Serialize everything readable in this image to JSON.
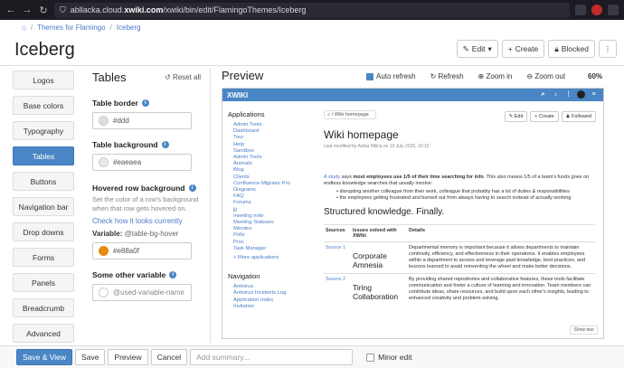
{
  "browser": {
    "url_prefix": "abllacka.cloud.",
    "url_domain": "xwiki.com",
    "url_path": "/xwiki/bin/edit/FlamingoThemes/Iceberg"
  },
  "breadcrumb": {
    "home": "⌂",
    "section": "Themes for Flamingo",
    "page": "Iceberg"
  },
  "page": {
    "title": "Iceberg"
  },
  "toolbar": {
    "edit": "Edit",
    "create": "Create",
    "blocked": "Blocked"
  },
  "sidebar": {
    "items": [
      {
        "label": "Logos"
      },
      {
        "label": "Base colors"
      },
      {
        "label": "Typography"
      },
      {
        "label": "Tables",
        "active": true
      },
      {
        "label": "Buttons"
      },
      {
        "label": "Navigation bar"
      },
      {
        "label": "Drop downs"
      },
      {
        "label": "Forms"
      },
      {
        "label": "Panels"
      },
      {
        "label": "Breadcrumb"
      },
      {
        "label": "Advanced"
      }
    ]
  },
  "tables": {
    "title": "Tables",
    "reset": "Reset all",
    "border_label": "Table border",
    "border_value": "#ddd",
    "border_color": "#dddddd",
    "bg_label": "Table background",
    "bg_value": "#eaeaea",
    "bg_color": "#eaeaea",
    "hover_label": "Hovered row background",
    "hover_hint": "Set the color of a row's background when that row gets hovered on.",
    "hover_link": "Check how it looks currently",
    "var_prefix": "Variable:",
    "var_name": "@table-bg-hover",
    "hover_value": "#e88a0f",
    "hover_color": "#e88a0f",
    "other_label": "Some other variable",
    "other_placeholder": "@used-variable-name"
  },
  "preview": {
    "title": "Preview",
    "auto_refresh": "Auto refresh",
    "refresh": "Refresh",
    "zoom_in": "Zoom in",
    "zoom_out": "Zoom out",
    "zoom": "60%"
  },
  "xwiki": {
    "logo": "XWIKI",
    "apps_title": "Applications",
    "apps": [
      "Admin Tools",
      "Dashboard",
      "Tour",
      "Help",
      "Sandbox",
      "Admin Tools",
      "Animals",
      "Blog",
      "Clients",
      "Confluence Migrator Pro",
      "Diagrams",
      "FAQ",
      "Forums",
      "jjj",
      "meeting note",
      "Meeting Statuses",
      "Minotes",
      "Polls",
      "Proc",
      "Task Manager"
    ],
    "more_apps": "More applications",
    "nav_title": "Navigation",
    "nav": [
      "Antivirus",
      "Antivirus Incidents Log",
      "Application Index",
      "Invitation"
    ],
    "crumb": "Wiki homepage",
    "title": "Wiki homepage",
    "modified": "Last modified by Adina Milica on 10 July 2025, 10:10",
    "edit": "Edit",
    "create": "Create",
    "followed": "Followed",
    "para_link": "A study",
    "para_bold": "most employees use 1/5 of their time searching for info",
    "para_text": "says",
    "para_end": ". This also means 1/5 of a team's funds goes on endless knowledge searches that usually involve:",
    "bullets": [
      "disrupting another colleague from their work, colleague that probably has a lot of duties & responsibilities",
      "the employees getting frustrated and burned out from always having to search instead of actually working"
    ],
    "h2": "Structured knowledge. Finally.",
    "th": [
      "Sources",
      "Issues solved with XWiki",
      "Details"
    ],
    "rows": [
      {
        "src": "Source 1",
        "issue": "Corporate Amnesia",
        "detail": "Departmental memory is important because it allows departments to maintain continuity, efficiency, and effectiveness in their operations. It enables employees within a department to access and leverage past knowledge, best practices, and lessons learned to avoid reinventing the wheel and make better decisions."
      },
      {
        "src": "Source 2",
        "issue": "Tiring Collaboration",
        "detail": "By providing shared repositories and collaborative features, these tools facilitate communication and foster a culture of learning and innovation. Team members can contribute ideas, share resources, and build upon each other's insights, leading to enhanced creativity and problem-solving."
      }
    ],
    "show_tour": "Show tour"
  },
  "bottom": {
    "save_view": "Save & View",
    "save": "Save",
    "preview": "Preview",
    "cancel": "Cancel",
    "summary_placeholder": "Add summary...",
    "minor": "Minor edit"
  }
}
